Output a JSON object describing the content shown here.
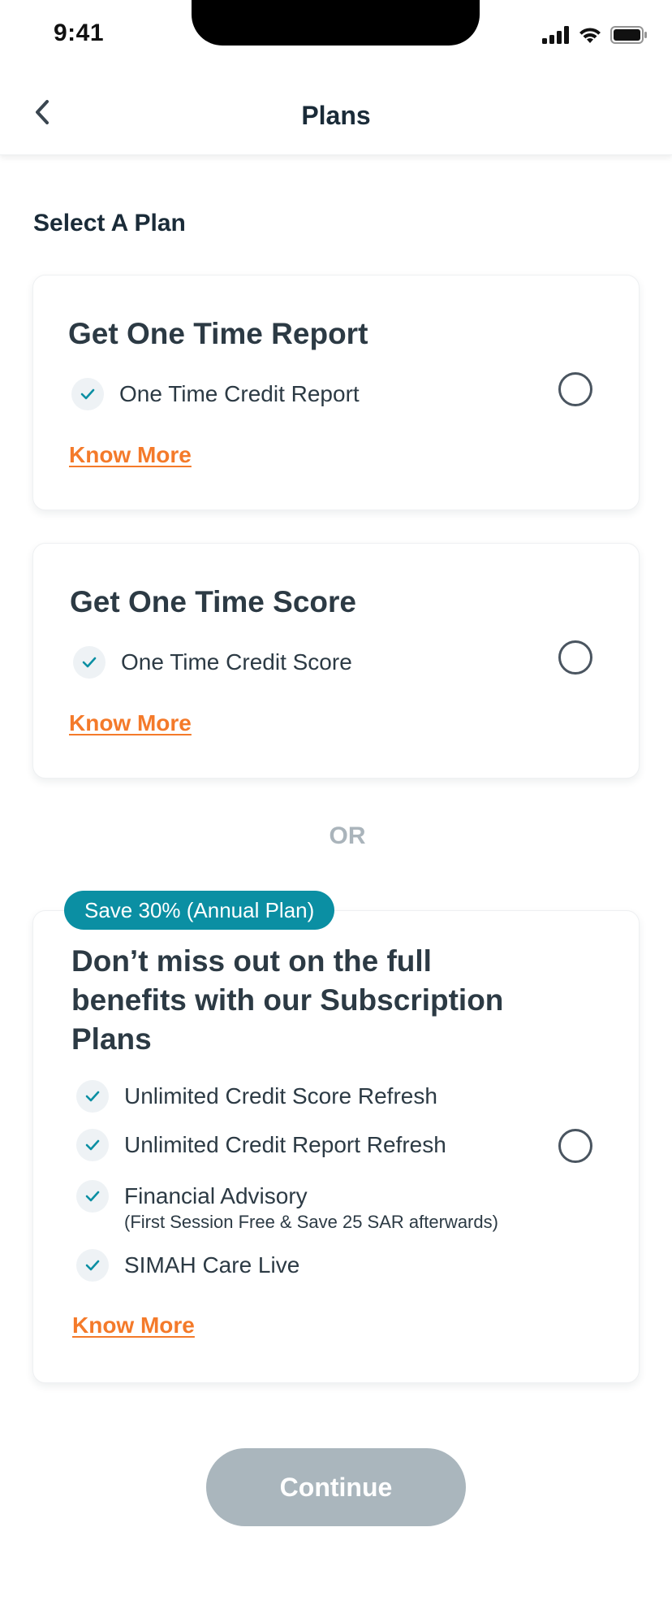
{
  "status_bar": {
    "time": "9:41"
  },
  "nav": {
    "title": "Plans",
    "back_icon": "chevron-left-icon"
  },
  "section_title": "Select A Plan",
  "plans": [
    {
      "title": "Get One Time Report",
      "features": [
        {
          "text": "One Time Credit Report"
        }
      ],
      "know_more": "Know More",
      "selected": false
    },
    {
      "title": "Get One Time Score",
      "features": [
        {
          "text": "One Time Credit Score"
        }
      ],
      "know_more": "Know More",
      "selected": false
    }
  ],
  "or_label": "OR",
  "subscription": {
    "badge": "Save 30% (Annual Plan)",
    "title_lines": [
      "Don’t miss out on the full",
      "benefits with our Subscription",
      "Plans"
    ],
    "features": [
      {
        "text": "Unlimited Credit Score Refresh",
        "sub": ""
      },
      {
        "text": "Unlimited Credit Report Refresh",
        "sub": ""
      },
      {
        "text": "Financial Advisory",
        "sub": "(First Session Free & Save 25 SAR afterwards)"
      },
      {
        "text": "SIMAH Care Live",
        "sub": ""
      }
    ],
    "know_more": "Know More",
    "selected": false
  },
  "continue_label": "Continue",
  "colors": {
    "accent": "#f47a2a",
    "badge": "#0b8fa3",
    "check": "#0b8fa3",
    "button_disabled": "#aab6bd"
  }
}
